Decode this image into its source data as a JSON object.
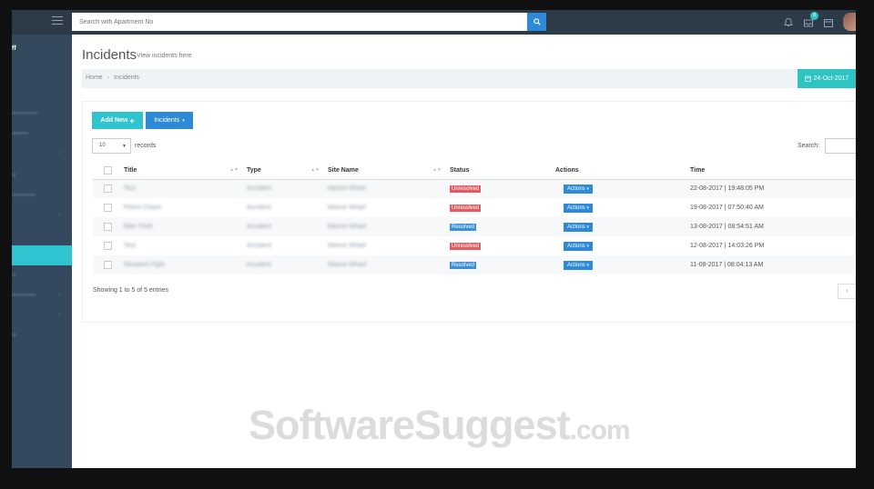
{
  "header": {
    "search_placeholder": "Search with Apartment No",
    "notification_badge": "8"
  },
  "sidebar": {
    "brand": "ff"
  },
  "page": {
    "title": "Incidents",
    "subtitle": "View incidents here"
  },
  "breadcrumb": [
    "Home",
    "Incidents"
  ],
  "date_button": "24-Oct-2017",
  "toolbar": {
    "add_new": "Add New",
    "incidents_dropdown": "Incidents"
  },
  "table_controls": {
    "page_length": "10",
    "records_label": "records",
    "search_label": "Search:"
  },
  "table": {
    "columns": [
      "Title",
      "Type",
      "Site Name",
      "Status",
      "Actions",
      "Time"
    ],
    "rows": [
      {
        "title": "Test",
        "type": "Accident",
        "site": "Marine Wharf",
        "status": "Unresolved",
        "status_color": "#e25b63",
        "action": "Actions",
        "time": "22-08-2017 | 19:48:05 PM"
      },
      {
        "title": "Police Chase",
        "type": "Accident",
        "site": "Marine Wharf",
        "status": "Unresolved",
        "status_color": "#e25b63",
        "action": "Actions",
        "time": "19-08-2017 | 07:50:40 AM"
      },
      {
        "title": "Bike Theft",
        "type": "Accident",
        "site": "Marine Wharf",
        "status": "Resolved",
        "status_color": "#3d8fd6",
        "action": "Actions",
        "time": "13-08-2017 | 08:54:51 AM"
      },
      {
        "title": "Test",
        "type": "Accident",
        "site": "Marine Wharf",
        "status": "Unresolved",
        "status_color": "#e25b63",
        "action": "Actions",
        "time": "12-08-2017 | 14:03:26 PM"
      },
      {
        "title": "Resident Fight",
        "type": "Accident",
        "site": "Marine Wharf",
        "status": "Resolved",
        "status_color": "#3d8fd6",
        "action": "Actions",
        "time": "11-08-2017 | 08:04:13 AM"
      }
    ]
  },
  "footer": {
    "info": "Showing 1 to 5 of 5 entries",
    "pager_prev": "‹"
  },
  "watermark": {
    "main": "SoftwareSuggest",
    "suffix": ".com"
  },
  "colors": {
    "topbar": "#2d3a48",
    "sidebar": "#34495e",
    "accent_teal": "#2ec4d0",
    "accent_blue": "#2e8ad6",
    "danger": "#e25b63"
  }
}
